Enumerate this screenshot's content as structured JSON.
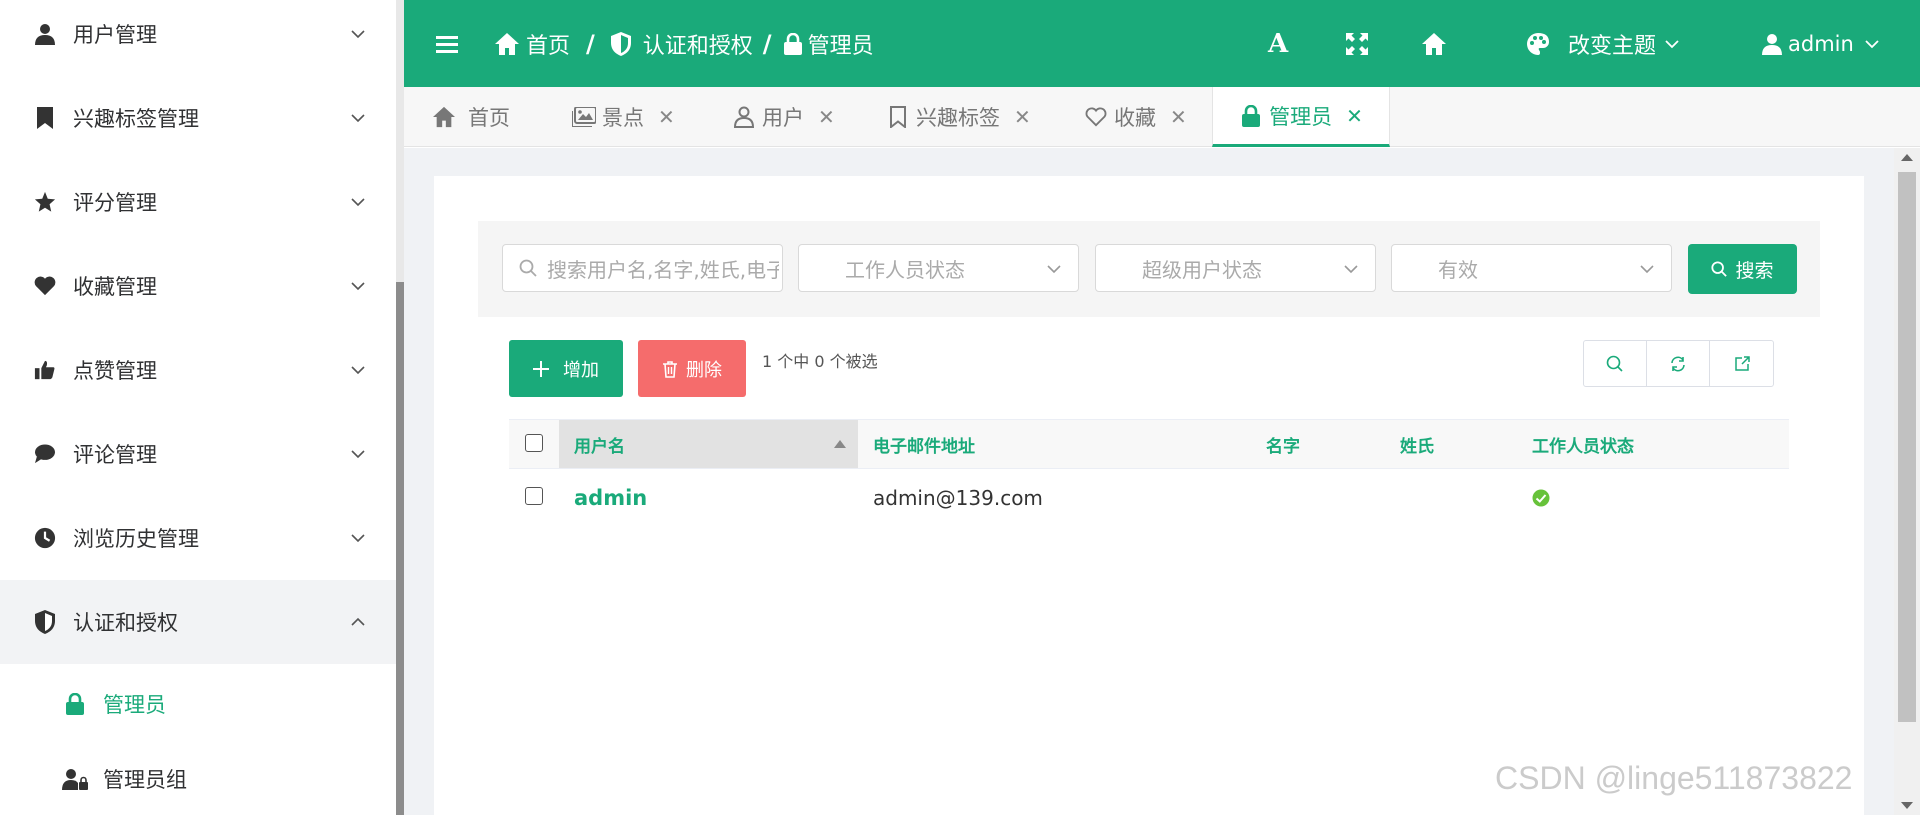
{
  "sidebar": {
    "items": [
      {
        "label": "用户管理",
        "icon": "user-icon"
      },
      {
        "label": "兴趣标签管理",
        "icon": "bookmark-icon"
      },
      {
        "label": "评分管理",
        "icon": "star-icon"
      },
      {
        "label": "收藏管理",
        "icon": "heart-icon"
      },
      {
        "label": "点赞管理",
        "icon": "thumbs-up-icon"
      },
      {
        "label": "评论管理",
        "icon": "comment-icon"
      },
      {
        "label": "浏览历史管理",
        "icon": "clock-icon"
      },
      {
        "label": "认证和授权",
        "icon": "shield-icon"
      }
    ],
    "subitems": [
      {
        "label": "管理员",
        "icon": "lock-icon"
      },
      {
        "label": "管理员组",
        "icon": "user-group-lock-icon"
      }
    ]
  },
  "header": {
    "breadcrumb": [
      "首页",
      "认证和授权",
      "管理员"
    ],
    "separator": "/",
    "theme_label": "改变主题",
    "user_label": "admin",
    "font_icon_glyph": "A"
  },
  "tabs": [
    {
      "label": "首页",
      "icon": "home-icon"
    },
    {
      "label": "景点",
      "icon": "image-icon",
      "close": "✕"
    },
    {
      "label": "用户",
      "icon": "user-outline-icon",
      "close": "✕"
    },
    {
      "label": "兴趣标签",
      "icon": "bookmark-outline-icon",
      "close": "✕"
    },
    {
      "label": "收藏",
      "icon": "heart-outline-icon",
      "close": "✕"
    },
    {
      "label": "管理员",
      "icon": "lock-icon",
      "close": "✕"
    }
  ],
  "filters": {
    "search_placeholder": "搜索用户名,名字,姓氏,电子邮件地址",
    "staff_status_placeholder": "工作人员状态",
    "superuser_status_placeholder": "超级用户状态",
    "active_placeholder": "有效",
    "search_button": "搜索"
  },
  "toolbar": {
    "add_label": "增加",
    "delete_label": "删除",
    "selection_text": "1 个中 0 个被选"
  },
  "table": {
    "columns": [
      "用户名",
      "电子邮件地址",
      "名字",
      "姓氏",
      "工作人员状态"
    ],
    "rows": [
      {
        "username": "admin",
        "email": "admin@139.com",
        "first_name": "",
        "last_name": "",
        "is_staff": true
      }
    ]
  },
  "watermark": "CSDN @linge511873822",
  "colors": {
    "primary": "#1aaa7a",
    "danger": "#f56c6c",
    "success": "#67c23a"
  }
}
